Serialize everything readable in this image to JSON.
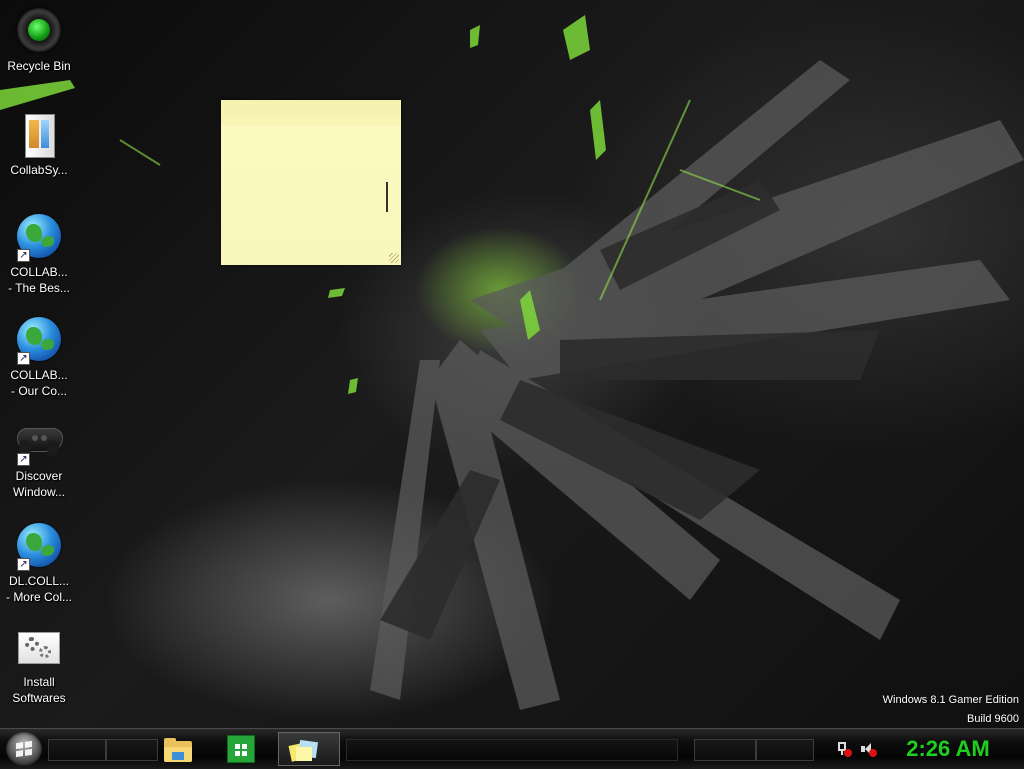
{
  "desktop": {
    "icons": [
      {
        "label": "Recycle Bin",
        "kind": "recycle-bin"
      },
      {
        "label": "CollabSy...",
        "kind": "app-folder"
      },
      {
        "label": "COLLAB...\n- The Bes...",
        "kind": "globe-shortcut"
      },
      {
        "label": "COLLAB...\n- Our Co...",
        "kind": "globe-shortcut"
      },
      {
        "label": "Discover\nWindow...",
        "kind": "gamepad-shortcut"
      },
      {
        "label": "DL.COLL...\n- More Col...",
        "kind": "globe-shortcut"
      },
      {
        "label": "Install\nSoftwares",
        "kind": "gears"
      }
    ],
    "shortcut_arrow": "↗"
  },
  "sticky_note": {
    "text": ""
  },
  "watermark": {
    "line1": "Windows 8.1 Gamer Edition",
    "line2": "Build 9600"
  },
  "taskbar": {
    "start_icon": "windows-logo-icon",
    "pinned": [
      {
        "name": "file-explorer",
        "icon": "folder-icon",
        "active": false
      },
      {
        "name": "store",
        "icon": "store-icon",
        "active": false
      },
      {
        "name": "sticky-notes",
        "icon": "sticky-notes-icon",
        "active": true
      }
    ],
    "tray": {
      "network_icon": "network-disconnected-icon",
      "volume_icon": "volume-muted-icon",
      "clock": "2:26 AM",
      "clock_color": "#1fcf1f"
    }
  }
}
